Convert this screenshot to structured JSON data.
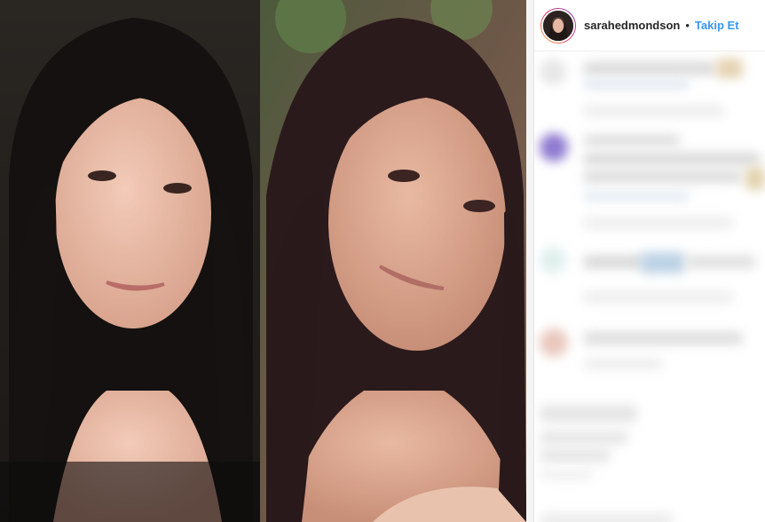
{
  "post": {
    "username": "sarahedmondson",
    "separator": "•",
    "follow_label": "Takip Et"
  },
  "icons": {
    "avatar": "profile-photo",
    "story_ring": "gradient-ring"
  },
  "colors": {
    "follow": "#3897f0",
    "username": "#262626"
  }
}
